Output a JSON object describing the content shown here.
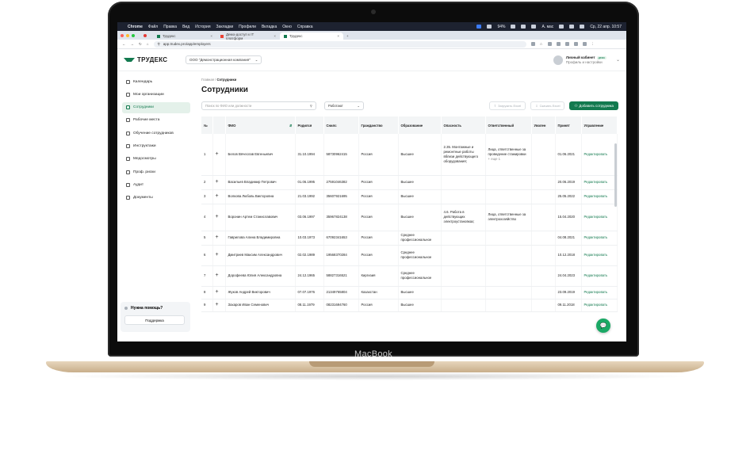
{
  "device_label": "MacBook",
  "menubar": {
    "app": "Chrome",
    "items": [
      "Файл",
      "Правка",
      "Вид",
      "История",
      "Закладки",
      "Профили",
      "Вкладка",
      "Окно",
      "Справка"
    ],
    "battery": "94%",
    "keyboard": "A. мас",
    "clock": "Ср, 22 апр. 10:57"
  },
  "tabs": [
    {
      "label": "Трудекс"
    },
    {
      "label": "Демо-доступ к IT платформ"
    },
    {
      "label": "Трудекс"
    }
  ],
  "address": {
    "url": "app.trudex.pro/app/employers"
  },
  "header": {
    "logo": "ТРУДЕКС",
    "company": "ООО \"Демонстрационная компания\"",
    "profile_title": "Личный кабинет",
    "profile_badge": "демо",
    "profile_sub": "Профиль и настройки"
  },
  "sidebar": {
    "items": [
      {
        "label": "Календарь"
      },
      {
        "label": "Мои организации"
      },
      {
        "label": "Сотрудники"
      },
      {
        "label": "Рабочие места"
      },
      {
        "label": "Обучение сотрудников"
      },
      {
        "label": "Инструктажи"
      },
      {
        "label": "Медосмотры"
      },
      {
        "label": "Проф. риски"
      },
      {
        "label": "Аудит"
      },
      {
        "label": "Документы"
      }
    ],
    "help_title": "Нужна помощь?",
    "help_button": "Поддержка"
  },
  "page": {
    "crumb_home": "Главная",
    "crumb_current": "Сотрудники",
    "title": "Сотрудники",
    "search_placeholder": "Поиск по ФИО или должности",
    "filter_value": "Работают",
    "export_label": "Загрузить Excel",
    "download_label": "Скачать Excel",
    "add_label": "Добавить сотрудника"
  },
  "table": {
    "headers": [
      "№",
      "",
      "ФИО",
      "Родился",
      "Снилс",
      "Гражданство",
      "Образование",
      "Опасность",
      "Ответственный",
      "Уволен",
      "Принят",
      "Управление"
    ],
    "edit_label": "Редактировать",
    "rows": [
      {
        "n": "1",
        "fio": "Белов Вячеслав Евгеньевич",
        "born": "31.10.1994",
        "snils": "58730962415",
        "cit": "Россия",
        "edu": "Высшее",
        "danger": "2.35. Монтажные и ремонтные работы вблизи действующего оборудования;",
        "resp": "Лица, ответственные за проведение стажировки",
        "more": "+ еще 1",
        "fired": "",
        "hired": "01.06.2021"
      },
      {
        "n": "2",
        "fio": "Васильев Владимир Петрович",
        "born": "01.06.1995",
        "snils": "27591046382",
        "cit": "Россия",
        "edu": "Высшее",
        "danger": "",
        "resp": "",
        "more": "",
        "fired": "",
        "hired": "20.06.2019"
      },
      {
        "n": "3",
        "fio": "Волкова Любовь Викторовна",
        "born": "21.03.1992",
        "snils": "35607921695",
        "cit": "Россия",
        "edu": "Высшее",
        "danger": "",
        "resp": "",
        "more": "",
        "fired": "",
        "hired": "25.05.2022"
      },
      {
        "n": "4",
        "fio": "Воронин Артем Станиславович",
        "born": "03.06.1997",
        "snils": "35967824138",
        "cit": "Россия",
        "edu": "Высшее",
        "danger": "4.6. Работа в действующих электроустановках;",
        "resp": "Лица, ответственные за электрохозяйство",
        "more": "",
        "fired": "",
        "hired": "15.04.2020"
      },
      {
        "n": "5",
        "fio": "Гаврилова Алина Владимировна",
        "born": "10.03.1973",
        "snils": "67092341653",
        "cit": "Россия",
        "edu": "Среднее профессиональное",
        "danger": "",
        "resp": "",
        "more": "",
        "fired": "",
        "hired": "04.08.2021"
      },
      {
        "n": "6",
        "fio": "Дмитриев Максим Александрович",
        "born": "02.02.1989",
        "snils": "19568370284",
        "cit": "Россия",
        "edu": "Среднее профессиональное",
        "danger": "",
        "resp": "",
        "more": "",
        "fired": "",
        "hired": "10.12.2018"
      },
      {
        "n": "7",
        "fio": "Дорофеева Юлия Александровна",
        "born": "24.12.1965",
        "snils": "58827316521",
        "cit": "Киргизия",
        "edu": "Среднее профессиональное",
        "danger": "",
        "resp": "",
        "more": "",
        "fired": "",
        "hired": "24.04.2023"
      },
      {
        "n": "8",
        "fio": "Жуков Андрей Викторович",
        "born": "07.07.1976",
        "snils": "21349765804",
        "cit": "Казахстан",
        "edu": "Высшее",
        "danger": "",
        "resp": "",
        "more": "",
        "fired": "",
        "hired": "23.09.2019"
      },
      {
        "n": "9",
        "fio": "Захаров Иван Семенович",
        "born": "08.11.1979",
        "snils": "08231694760",
        "cit": "Россия",
        "edu": "Высшее",
        "danger": "",
        "resp": "",
        "more": "",
        "fired": "",
        "hired": "09.11.2018"
      }
    ]
  }
}
